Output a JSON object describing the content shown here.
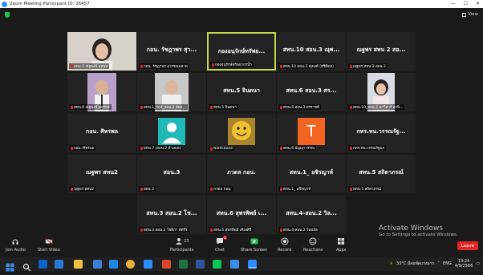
{
  "window": {
    "title": "Zoom Meeting Participant ID: 26457",
    "min": "—",
    "max": "☐",
    "close": "✕"
  },
  "view_label": "View",
  "tiles": [
    {
      "big": "",
      "name": "สพม.6 ณัฐพงษ์ สหพม",
      "photo": "woman"
    },
    {
      "big": "กอน. รัชฎาพร สุว...",
      "name": "กอน. รัชฎาพร สุวรรณฉลาด"
    },
    {
      "big": "กองอนุรักษ์ทรัพย...",
      "name": "กองอนุรักษ์ทรัพยากรน้ำ",
      "active": true
    },
    {
      "big": "สทน.10 สอน.3 ณุพ...",
      "name": "สทน.10 สอน.3 ณุพงศ์ (หรีดิดม)"
    },
    {
      "big": "ณฐพร สทน 2 สอ...",
      "name": "ณฐพร สทน 2 สอน.2"
    },
    {
      "big": "",
      "name": "สทน.6 ณัฐพงษ์ อนุรักษ์",
      "photo": "man1"
    },
    {
      "big": "",
      "name": "สทน.1_รักษ์_สอน.2 จันก...",
      "photo": "man2"
    },
    {
      "big": "สทน.5 จินดนา",
      "name": "สทน.5 จินดนา"
    },
    {
      "big": "สทน.6 สอน.3 ศร...",
      "name": "สทน.6 สอน.3 ศรราชท์"
    },
    {
      "big": "",
      "name": "สทน.10_สอน.2 นาวิสาร์ อักษิ...",
      "photo": "woman2"
    },
    {
      "big": "กอน. ศิทรพล",
      "name": "กอน. ศิทรพล"
    },
    {
      "big": "",
      "name": "สทน.7 (สอน.2 ลำเอเต)",
      "photo": "person-icon"
    },
    {
      "big": "",
      "name": "Natthawan",
      "photo": "smiley"
    },
    {
      "big": "",
      "name": "สทน.6 อัญญาวรรณ",
      "photo": "letter-t",
      "letter": "T"
    },
    {
      "big": "กทร.ทน.วรรณรัฐ...",
      "name": "กทร.ทน.วรรณรัฐนก"
    },
    {
      "big": "ณฐพร สทน2",
      "name": "ณฐพร สทน2"
    },
    {
      "big": "สอน.3",
      "name": "สอน.3"
    },
    {
      "big": "ภวดล กอน.",
      "name": "ภวดล กอน."
    },
    {
      "big": "สทน.1_ อชิรญาห์",
      "name": "สทน.1_ อชิรญาห์"
    },
    {
      "big": "สทน.5 สถิตาภรณ์",
      "name": "สทน.5 สถิตาภรณ์"
    },
    {
      "big": "สทน.3 สอน.2 โช...",
      "name": "สทน.3 สอน.2 โชติกา ทัศรีร"
    },
    {
      "big": "สทน.6 สุพรพิพย์ เ...",
      "name": "สทน.6 สุพรพิพย์ เคียงศิริ"
    },
    {
      "big": "สทน.4-สอน.2 วิล...",
      "name": "สทน.4-สอน.2 วิลมลัล"
    }
  ],
  "toolbar": {
    "join_audio": "Join Audio",
    "start_video": "Start Video",
    "participants": "Participants",
    "participants_count": "23",
    "chat": "Chat",
    "chat_badge": "1",
    "share_screen": "Share Screen",
    "record": "Record",
    "reactions": "Reactions",
    "apps": "Apps",
    "leave": "Leave"
  },
  "activate": {
    "line1": "Activate Windows",
    "line2": "Go to Settings to activate Windows."
  },
  "taskbar": {
    "weather": "33°C มีลมพัดแรงมาก",
    "lang": "ENG",
    "time": "13:24",
    "date": "4/9/2566"
  },
  "colors": {
    "active_border": "#c8d84a",
    "leave": "#e02828",
    "share": "#23c552"
  }
}
